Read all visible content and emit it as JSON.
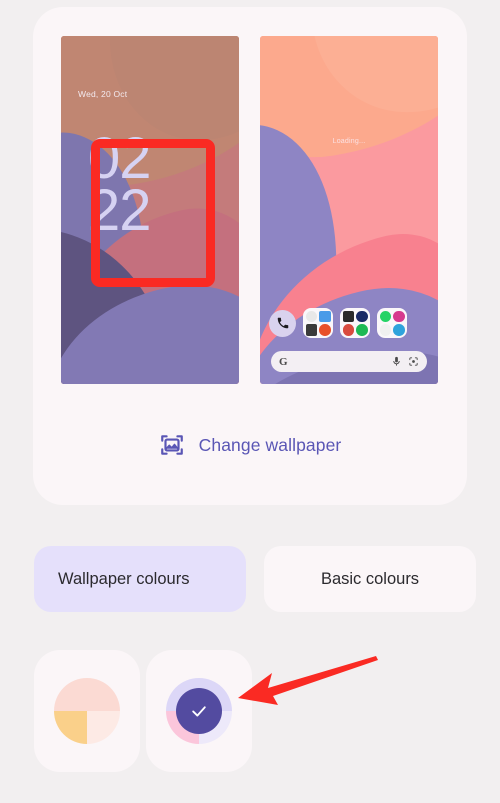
{
  "page": {
    "background_color": "#F2EFF0",
    "card_color": "#FBF6F8"
  },
  "preview": {
    "lock_screen": {
      "name": "lock-screen-preview",
      "date": "Wed, 20 Oct",
      "clock_hours": "02",
      "clock_minutes": "22",
      "clock_color": "#D6D2F2",
      "highlight_box_color": "#FA2A23"
    },
    "home_screen": {
      "name": "home-screen-preview",
      "status_text": "Loading...",
      "dock": {
        "phone_app": "phone-icon",
        "folders": [
          {
            "label": "folder-1",
            "apps": [
              "photos-icon",
              "messages-icon",
              "camera-icon",
              "firefox-icon"
            ]
          },
          {
            "label": "folder-2",
            "apps": [
              "youtube-icon",
              "visa-icon",
              "chrome-icon",
              "spotify-icon"
            ]
          },
          {
            "label": "folder-3",
            "apps": [
              "whatsapp-icon",
              "instagram-icon",
              "messenger-icon",
              "telegram-icon"
            ]
          }
        ]
      },
      "search": {
        "logo": "google-g-logo",
        "mic_icon": "microphone-icon",
        "lens_icon": "google-lens-icon"
      }
    }
  },
  "change_wallpaper": {
    "icon": "image-picture-icon",
    "label": "Change wallpaper",
    "color": "#5A56B5"
  },
  "tabs": [
    {
      "label": "Wallpaper colours",
      "active": true,
      "bg": "#E5E0FB"
    },
    {
      "label": "Basic colours",
      "active": false,
      "bg": "#FBF6F8"
    }
  ],
  "swatches": [
    {
      "name": "wallpaper-colour-option-1",
      "selected": false,
      "quadrants": {
        "tl": "#FBDAD3",
        "tr": "#FBDAD3",
        "bl": "#FAD08A",
        "br": "#FDEAE5"
      }
    },
    {
      "name": "wallpaper-colour-option-2",
      "selected": true,
      "quadrants": {
        "tl": "#DCD7F7",
        "tr": "#DCD7F7",
        "bl": "#FBC6DB",
        "br": "#EDE9FA"
      },
      "center_color": "#534BA0",
      "check_icon": "checkmark-icon"
    }
  ],
  "annotation": {
    "arrow": "red-pointer-arrow",
    "color": "#FA2A23"
  }
}
